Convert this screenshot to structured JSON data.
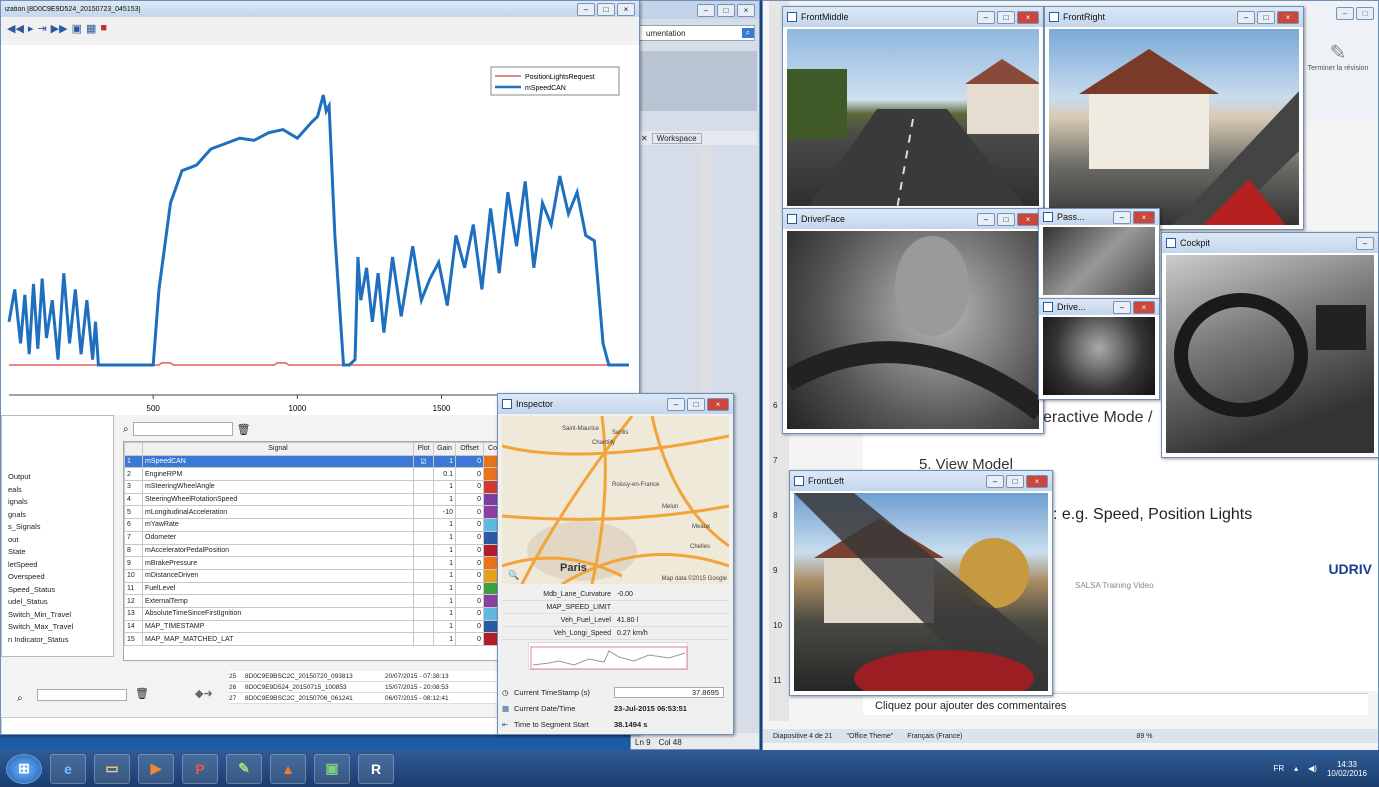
{
  "signal_window": {
    "title": "ization [8D0C9E9D524_20150723_045153]",
    "legend": [
      "PositionLightsRequest",
      "mSpeedCAN"
    ],
    "x_ticks": [
      "500",
      "1000",
      "1500"
    ],
    "table_headers": [
      "Signal",
      "Plot",
      "Gain",
      "Offset",
      "Co"
    ],
    "signals": [
      {
        "n": "1",
        "name": "mSpeedCAN",
        "plot": "☑",
        "gain": "1",
        "offset": "0",
        "color": "#e8731a"
      },
      {
        "n": "2",
        "name": "EngineRPM",
        "plot": "",
        "gain": "0.1",
        "offset": "0",
        "color": "#e8731a"
      },
      {
        "n": "3",
        "name": "mSteeringWheelAngle",
        "plot": "",
        "gain": "1",
        "offset": "0",
        "color": "#d23a2e"
      },
      {
        "n": "4",
        "name": "SteeringWheelRotationSpeed",
        "plot": "",
        "gain": "1",
        "offset": "0",
        "color": "#7a3fa0"
      },
      {
        "n": "5",
        "name": "mLongitudinalAcceleration",
        "plot": "",
        "gain": "-10",
        "offset": "0",
        "color": "#8c3fa0"
      },
      {
        "n": "6",
        "name": "mYawRate",
        "plot": "",
        "gain": "1",
        "offset": "0",
        "color": "#5fb8e0"
      },
      {
        "n": "7",
        "name": "Odometer",
        "plot": "",
        "gain": "1",
        "offset": "0",
        "color": "#2a5aa0"
      },
      {
        "n": "8",
        "name": "mAcceleratorPedalPosition",
        "plot": "",
        "gain": "1",
        "offset": "0",
        "color": "#b01e2e"
      },
      {
        "n": "9",
        "name": "mBrakePressure",
        "plot": "",
        "gain": "1",
        "offset": "0",
        "color": "#e8731a"
      },
      {
        "n": "10",
        "name": "mDistanceDriven",
        "plot": "",
        "gain": "1",
        "offset": "0",
        "color": "#e8a01a"
      },
      {
        "n": "11",
        "name": "FuelLevel",
        "plot": "",
        "gain": "1",
        "offset": "0",
        "color": "#3fa03f"
      },
      {
        "n": "12",
        "name": "ExternalTemp",
        "plot": "",
        "gain": "1",
        "offset": "0",
        "color": "#8c3fa0"
      },
      {
        "n": "13",
        "name": "AbsoluteTimeSinceFirstIgnition",
        "plot": "",
        "gain": "1",
        "offset": "0",
        "color": "#5fb8e0"
      },
      {
        "n": "14",
        "name": "MAP_TIMESTAMP",
        "plot": "",
        "gain": "1",
        "offset": "0",
        "color": "#2a5aa0"
      },
      {
        "n": "15",
        "name": "MAP_MAP_MATCHED_LAT",
        "plot": "",
        "gain": "1",
        "offset": "0",
        "color": "#b01e2e"
      }
    ],
    "tree_items": [
      "Output",
      "eals",
      "ignals",
      "gnals",
      "s_Signals",
      "out",
      "State",
      "letSpeed",
      "Overspeed",
      "Speed_Status",
      "udel_Status",
      "Switch_Min_Travel",
      "Switch_Max_Travel",
      "n Indicator_Status"
    ],
    "search_placeholder": "",
    "trips": [
      {
        "n": "25",
        "name": "8D0C9E9BSC2C_20150720_093813",
        "date": "20/07/2015 - 07:38:13"
      },
      {
        "n": "26",
        "name": "8D0C9E9D524_20150715_100853",
        "date": "15/07/2015 - 20:08:53"
      },
      {
        "n": "27",
        "name": "8D0C9E9BSC2C_20150706_061241",
        "date": "06/07/2015 - 08:12:41"
      }
    ]
  },
  "background_ide": {
    "search_text": "umentation",
    "workspace_tab": "Workspace",
    "status_left": "Output",
    "status_ln": "Ln 9",
    "status_col": "Col 48"
  },
  "inspector": {
    "title": "Inspector",
    "map_city": "Paris",
    "map_labels": [
      "Saint-Maurice",
      "Chantilly",
      "Senlis",
      "Roissy-en-France",
      "Meaux",
      "Chelles",
      "Melun"
    ],
    "map_credit": "Map data ©2015 Google",
    "fields": [
      {
        "label": "Mdb_Lane_Curvature",
        "value": "-0.00"
      },
      {
        "label": "MAP_SPEED_LIMIT",
        "value": ""
      },
      {
        "label": "Veh_Fuel_Level",
        "value": "41.80 l"
      },
      {
        "label": "Veh_Longi_Speed",
        "value": "0.27 km/h"
      }
    ],
    "timestamp_label": "Current TimeStamp (s)",
    "timestamp_value": "37.8695",
    "datetime_label": "Current Date/Time",
    "datetime_value": "23-Jul-2015 06:53:51",
    "segment_label": "Time to Segment Start",
    "segment_value": "38.1494 s"
  },
  "cameras": {
    "front_middle": "FrontMiddle",
    "front_right": "FrontRight",
    "driver_face": "DriverFace",
    "pass": "Pass...",
    "driver_feet": "Drive...",
    "cockpit": "Cockpit",
    "front_left": "FrontLeft"
  },
  "powerpoint": {
    "button_label": "Terminer la révision",
    "slide_text_1": "eractive Mode /",
    "slide_text_2": "5.  View Model",
    "slide_text_3": ": e.g. Speed, Position Lights",
    "slide_footer": "SALSA Training Video",
    "brand": "UDRIV",
    "notes_placeholder": "Cliquez pour ajouter des commentaires",
    "status_slide": "Diapositive 4 de 21",
    "status_theme": "\"Office Theme\"",
    "status_lang": "Français (France)",
    "zoom": "89 %",
    "slide_numbers": [
      "6",
      "7",
      "8",
      "9",
      "10",
      "11"
    ]
  },
  "taskbar": {
    "apps": [
      "start-orb",
      "ie",
      "explorer",
      "media",
      "powerpoint",
      "notes",
      "matlab",
      "image",
      "r"
    ],
    "lang": "FR",
    "time": "14:33",
    "date": "10/02/2016"
  },
  "chart_data": {
    "type": "line",
    "title": "",
    "xlabel": "",
    "ylabel": "",
    "xlim": [
      0,
      2150
    ],
    "x_ticks": [
      500,
      1000,
      1500
    ],
    "legend_position": "top-right",
    "series": [
      {
        "name": "PositionLightsRequest",
        "color": "#e06060",
        "x": [
          0,
          520,
          530,
          560,
          570,
          920,
          930,
          960,
          970,
          2150
        ],
        "y": [
          0,
          0,
          2,
          2,
          0,
          0,
          2,
          2,
          0,
          0
        ]
      },
      {
        "name": "mSpeedCAN",
        "color": "#1f6fbf",
        "x": [
          0,
          20,
          40,
          55,
          70,
          85,
          100,
          115,
          130,
          150,
          170,
          190,
          210,
          230,
          250,
          270,
          290,
          300,
          310,
          330,
          350,
          380,
          400,
          420,
          450,
          480,
          500,
          520,
          540,
          560,
          600,
          650,
          700,
          750,
          800,
          850,
          900,
          950,
          1000,
          1050,
          1070,
          1090,
          1100,
          1110,
          1130,
          1160,
          1180,
          1200,
          1210,
          1220,
          1240,
          1260,
          1280,
          1300,
          1330,
          1360,
          1400,
          1430,
          1460,
          1490,
          1520,
          1550,
          1580,
          1610,
          1640,
          1670,
          1700,
          1730,
          1760,
          1790,
          1820,
          1850,
          1880,
          1910,
          1940,
          1970,
          2000,
          2030,
          2060,
          2080,
          2100,
          2150
        ],
        "y": [
          40,
          70,
          20,
          65,
          10,
          75,
          15,
          80,
          25,
          60,
          5,
          85,
          20,
          70,
          10,
          60,
          5,
          40,
          0,
          0,
          0,
          0,
          0,
          0,
          0,
          0,
          0,
          70,
          110,
          150,
          180,
          185,
          200,
          205,
          210,
          208,
          215,
          218,
          210,
          225,
          230,
          250,
          235,
          240,
          120,
          0,
          0,
          5,
          100,
          60,
          90,
          40,
          85,
          30,
          100,
          45,
          110,
          60,
          80,
          95,
          55,
          120,
          90,
          130,
          70,
          145,
          85,
          160,
          110,
          170,
          90,
          150,
          130,
          175,
          140,
          160,
          120,
          115,
          20,
          0,
          0,
          0
        ]
      }
    ]
  }
}
